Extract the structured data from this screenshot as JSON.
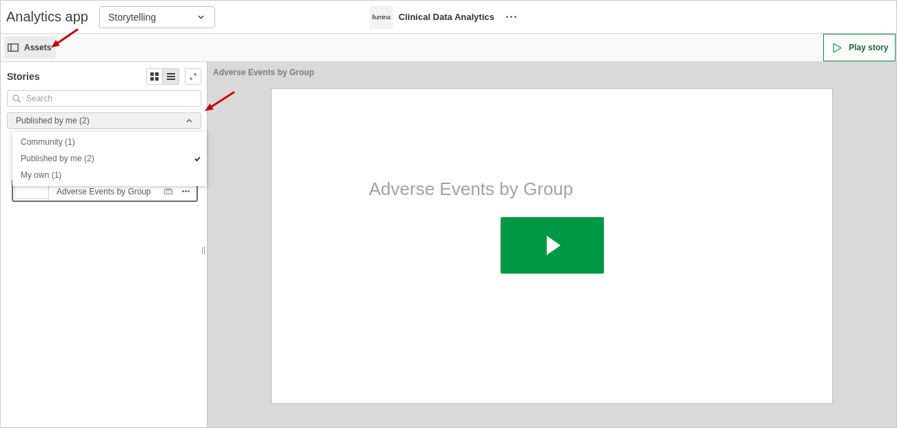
{
  "header": {
    "app_title": "Analytics app",
    "mode_select": {
      "value": "Storytelling"
    },
    "logo_text": "llumina",
    "app_name": "Clinical Data Analytics"
  },
  "toolbar": {
    "assets_button": {
      "label": "Assets",
      "active": true
    },
    "play_button": {
      "label": "Play story"
    }
  },
  "assets_panel": {
    "title": "Stories",
    "view_modes": [
      {
        "kind": "grid",
        "selected": false
      },
      {
        "kind": "list",
        "selected": true
      }
    ],
    "search": {
      "placeholder": "Search"
    },
    "filter": {
      "value": "Published by me (2)",
      "expanded": true,
      "options": [
        {
          "label": "Community (1)",
          "selected": false
        },
        {
          "label": "Published by me (2)",
          "selected": true
        },
        {
          "label": "My own (1)",
          "selected": false
        }
      ]
    },
    "stories": [
      {
        "title": "Adverse Events by Group",
        "selected": true
      }
    ]
  },
  "story_view": {
    "title": "Adverse Events by Group",
    "slide": {
      "title": "Adverse Events by Group"
    }
  }
}
